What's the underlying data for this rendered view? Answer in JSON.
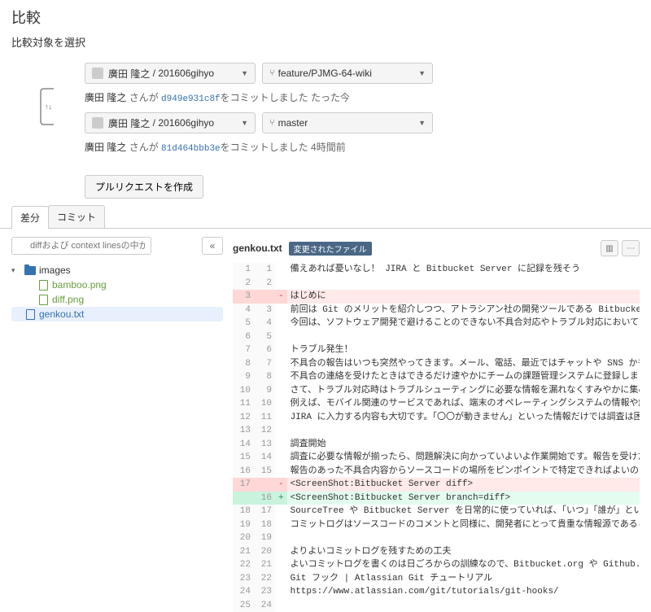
{
  "title": "比較",
  "subtitle": "比較対象を選択",
  "source": {
    "repo_user": "廣田 隆之",
    "repo_name": "201606gihyo",
    "branch": "feature/PJMG-64-wiki",
    "commit_author": "廣田 隆之",
    "commit_hash": "d949e931c8f",
    "commit_verb": "をコミットしました",
    "commit_when": "たった今",
    "san": "さんが"
  },
  "target": {
    "repo_user": "廣田 隆之",
    "repo_name": "201606gihyo",
    "branch": "master",
    "commit_author": "廣田 隆之",
    "commit_hash": "81d464bbb3e",
    "commit_verb": "をコミットしました",
    "commit_when": "4時間前",
    "san": "さんが"
  },
  "pull_request_btn": "プルリクエストを作成",
  "tabs": {
    "diff": "差分",
    "commits": "コミット"
  },
  "filter_placeholder": "diffおよび context linesの中からテキストを見つ",
  "tree": {
    "folder": "images",
    "files": [
      "bamboo.png",
      "diff.png"
    ],
    "root_file": "genkou.txt"
  },
  "diff": {
    "filename": "genkou.txt",
    "badge": "変更されたファイル",
    "lines": [
      {
        "o": "1",
        "n": "1",
        "t": "備えあれば憂いなし！ JIRA と Bitbucket Server に記録を残そう",
        "c": "n"
      },
      {
        "o": "2",
        "n": "2",
        "t": "",
        "c": "n"
      },
      {
        "o": "3",
        "n": "",
        "t": "はじめに",
        "c": "r"
      },
      {
        "o": "4",
        "n": "3",
        "t": "前回は Git のメリットを紹介しつつ、アトラシアン社の開発ツールである Bitbucket Server や SourceTree の使い方を説明し",
        "c": "n"
      },
      {
        "o": "5",
        "n": "4",
        "t": "今回は、ソフトウェア開発で避けることのできない不具合対応やトラブル対応において JIRA や Bitbucket Server をどのように",
        "c": "n"
      },
      {
        "o": "6",
        "n": "5",
        "t": "",
        "c": "n"
      },
      {
        "o": "7",
        "n": "6",
        "t": "トラブル発生！",
        "c": "n"
      },
      {
        "o": "8",
        "n": "7",
        "t": "不具合の報告はいつも突然やってきます。メール、電話、最近ではチャットや SNS かもしれません。障害の報告というのは決し",
        "c": "n"
      },
      {
        "o": "9",
        "n": "8",
        "t": "不具合の連絡を受けたときはできるだけ速やかにチームの課題管理システムに登録しましょう。どんな形であれ、記録を残すの",
        "c": "n"
      },
      {
        "o": "10",
        "n": "9",
        "t": "さて、トラブル対応時はトラブルシューティングに必要な情報を漏れなくすみやかに集めることが重要です。JIRA はそのための",
        "c": "n"
      },
      {
        "o": "11",
        "n": "10",
        "t": "例えば、モバイル関連のサービスであれば、端末のオペレーティングシステムの情報や解像度などの環境情報が重要になること",
        "c": "n"
      },
      {
        "o": "12",
        "n": "11",
        "t": "JIRA に入力する内容も大切です。「〇〇が動きません」といった情報だけでは調査は困難なものになります。「再現手順」「期",
        "c": "n"
      },
      {
        "o": "13",
        "n": "12",
        "t": "",
        "c": "n"
      },
      {
        "o": "14",
        "n": "13",
        "t": "調査開始",
        "c": "n"
      },
      {
        "o": "15",
        "n": "14",
        "t": "調査に必要な情報が揃ったら、問題解決に向かっていよいよ作業開始です。報告を受けた時点ですぐに原因がわかればよいので",
        "c": "n"
      },
      {
        "o": "16",
        "n": "15",
        "t": "報告のあった不具合内容からソースコードの場所をピンポイントで特定できればよいのですが、原因がすぐに判明しないことも",
        "c": "n"
      },
      {
        "o": "17",
        "n": "",
        "t": "<ScreenShot:Bitbucket Server diff>",
        "c": "r"
      },
      {
        "o": "",
        "n": "16",
        "t": "<ScreenShot:Bitbucket Server branch=diff>",
        "c": "a"
      },
      {
        "o": "18",
        "n": "17",
        "t": "SourceTree や Bitbucket Server を日常的に使っていれば、「いつ」「誰が」という情報は自動的に記録されていきます。しか",
        "c": "n"
      },
      {
        "o": "19",
        "n": "18",
        "t": "コミットログはソースコードのコメントと同様に、開発者にとって貴重な情報源であることを覚えておきましょう。とはいえ、こ",
        "c": "n"
      },
      {
        "o": "20",
        "n": "19",
        "t": "",
        "c": "n"
      },
      {
        "o": "21",
        "n": "20",
        "t": "よりよいコミットログを残すための工夫",
        "c": "n"
      },
      {
        "o": "22",
        "n": "21",
        "t": "よいコミットログを書くのは日ごろからの訓練なので、Bitbucket.org や Github.com でホストされているオープンソースソフ",
        "c": "n"
      },
      {
        "o": "23",
        "n": "22",
        "t": "Git フック | Atlassian Git チュートリアル",
        "c": "n"
      },
      {
        "o": "24",
        "n": "23",
        "t": "https://www.atlassian.com/git/tutorials/git-hooks/",
        "c": "n"
      },
      {
        "o": "25",
        "n": "24",
        "t": "",
        "c": "n"
      }
    ]
  }
}
